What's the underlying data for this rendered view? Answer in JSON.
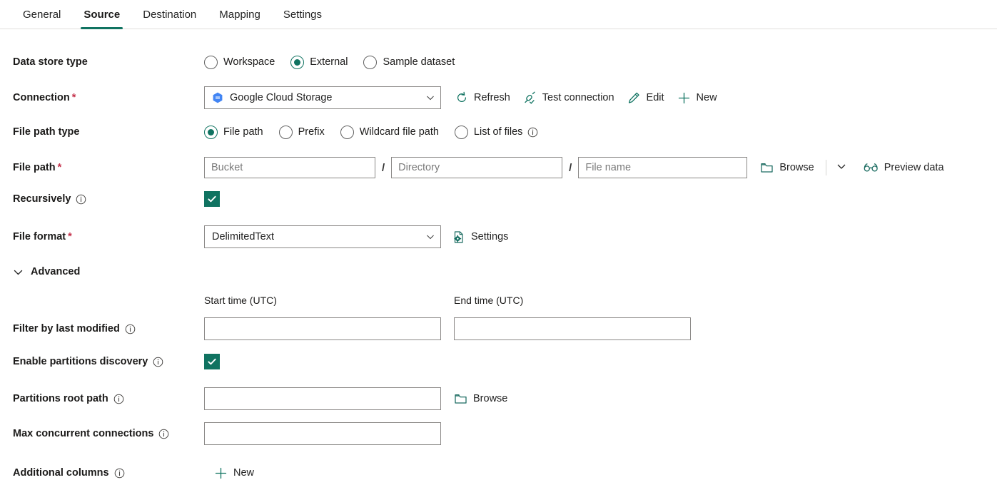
{
  "tabs": [
    {
      "label": "General",
      "active": false
    },
    {
      "label": "Source",
      "active": true
    },
    {
      "label": "Destination",
      "active": false
    },
    {
      "label": "Mapping",
      "active": false
    },
    {
      "label": "Settings",
      "active": false
    }
  ],
  "colors": {
    "accent": "#107361",
    "required": "#c4314b",
    "gcs_blue": "#4285f4",
    "border": "#8a8886"
  },
  "form": {
    "data_store_type": {
      "label": "Data store type",
      "options": [
        {
          "label": "Workspace",
          "selected": false
        },
        {
          "label": "External",
          "selected": true
        },
        {
          "label": "Sample dataset",
          "selected": false
        }
      ]
    },
    "connection": {
      "label": "Connection",
      "required": true,
      "value": "Google Cloud Storage",
      "commands": [
        {
          "label": "Refresh",
          "icon": "refresh-icon"
        },
        {
          "label": "Test connection",
          "icon": "test-connection-icon"
        },
        {
          "label": "Edit",
          "icon": "pencil-icon"
        },
        {
          "label": "New",
          "icon": "plus-icon"
        }
      ]
    },
    "file_path_type": {
      "label": "File path type",
      "options": [
        {
          "label": "File path",
          "selected": true,
          "info": false
        },
        {
          "label": "Prefix",
          "selected": false,
          "info": false
        },
        {
          "label": "Wildcard file path",
          "selected": false,
          "info": false
        },
        {
          "label": "List of files",
          "selected": false,
          "info": true
        }
      ]
    },
    "file_path": {
      "label": "File path",
      "required": true,
      "bucket_placeholder": "Bucket",
      "bucket_value": "",
      "directory_placeholder": "Directory",
      "directory_value": "",
      "filename_placeholder": "File name",
      "filename_value": "",
      "separator": "/",
      "browse_label": "Browse",
      "preview_label": "Preview data"
    },
    "recursively": {
      "label": "Recursively",
      "info": true,
      "checked": true
    },
    "file_format": {
      "label": "File format",
      "required": true,
      "value": "DelimitedText",
      "settings_label": "Settings"
    },
    "advanced": {
      "label": "Advanced",
      "expanded": true
    },
    "filter_by_last_modified": {
      "label": "Filter by last modified",
      "info": true,
      "start_header": "Start time (UTC)",
      "start_value": "",
      "end_header": "End time (UTC)",
      "end_value": ""
    },
    "enable_partitions_discovery": {
      "label": "Enable partitions discovery",
      "info": true,
      "checked": true
    },
    "partitions_root_path": {
      "label": "Partitions root path",
      "info": true,
      "value": "",
      "browse_label": "Browse"
    },
    "max_concurrent_connections": {
      "label": "Max concurrent connections",
      "info": true,
      "value": ""
    },
    "additional_columns": {
      "label": "Additional columns",
      "info": true,
      "new_label": "New"
    }
  }
}
